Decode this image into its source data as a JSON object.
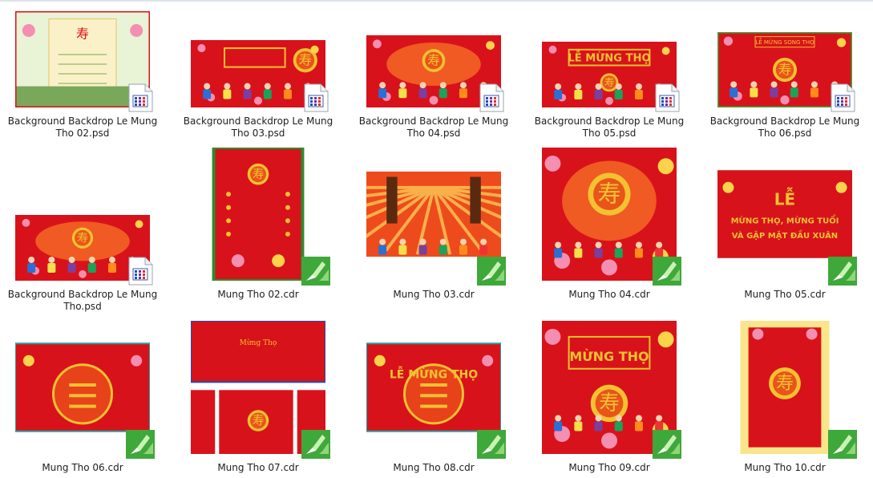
{
  "files": [
    {
      "name": "Background Backdrop Le Mung Tho 02.psd",
      "type": "psd",
      "thumb": "scroll"
    },
    {
      "name": "Background Backdrop Le Mung Tho 03.psd",
      "type": "psd",
      "thumb": "banner"
    },
    {
      "name": "Background Backdrop Le Mung Tho 04.psd",
      "type": "psd",
      "thumb": "stage"
    },
    {
      "name": "Background Backdrop Le Mung Tho 05.psd",
      "type": "psd",
      "thumb": "title",
      "caption": "LỄ MỪNG THỌ"
    },
    {
      "name": "Background Backdrop Le Mung Tho 06.psd",
      "type": "psd",
      "thumb": "title2",
      "caption": "LỄ MỪNG SONG THỌ"
    },
    {
      "name": "Background Backdrop Le Mung Tho.psd",
      "type": "psd",
      "thumb": "stage"
    },
    {
      "name": "Mung Tho 02.cdr",
      "type": "cdr",
      "thumb": "vertical"
    },
    {
      "name": "Mung Tho 03.cdr",
      "type": "cdr",
      "thumb": "sunburst"
    },
    {
      "name": "Mung Tho 04.cdr",
      "type": "cdr",
      "thumb": "stage"
    },
    {
      "name": "Mung Tho 05.cdr",
      "type": "cdr",
      "thumb": "text",
      "caption": "LỄ",
      "caption2": "MỪNG THỌ, MỪNG TUỔI",
      "caption3": "VÀ GẶP MẶT ĐẦU XUÂN"
    },
    {
      "name": "Mung Tho 06.cdr",
      "type": "cdr",
      "thumb": "symbol"
    },
    {
      "name": "Mung Tho 07.cdr",
      "type": "cdr",
      "thumb": "multi",
      "caption": "Mừng Thọ"
    },
    {
      "name": "Mung Tho 08.cdr",
      "type": "cdr",
      "thumb": "symbol",
      "caption": "LỄ MỪNG THỌ"
    },
    {
      "name": "Mung Tho 09.cdr",
      "type": "cdr",
      "thumb": "title",
      "caption": "MỪNG THỌ"
    },
    {
      "name": "Mung Tho 10.cdr",
      "type": "cdr",
      "thumb": "vertical2"
    }
  ],
  "colors": {
    "red": "#d8121b",
    "gold": "#f2c230",
    "green": "#2e8b2e",
    "cream": "#fbf1c8"
  },
  "icons": {
    "psd": "psd-file-icon",
    "cdr": "coreldraw-file-icon"
  }
}
